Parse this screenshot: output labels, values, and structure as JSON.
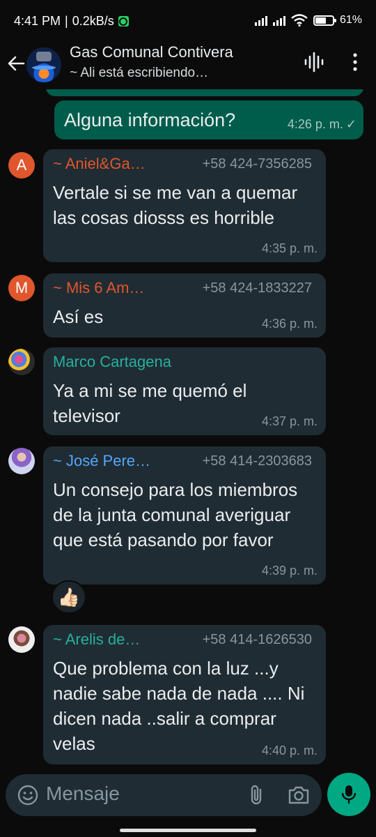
{
  "status": {
    "time": "4:41 PM",
    "speed": "0.2kB/s",
    "battery": "61"
  },
  "header": {
    "title": "Gas Comunal Contivera",
    "subtitle": "~ Ali está escribiendo…"
  },
  "messages": [
    {
      "type": "out",
      "text": "Alguna información?",
      "time": "4:26 p. m."
    },
    {
      "type": "in",
      "avatar_letter": "A",
      "sender": "~ Aniel&Ga…",
      "sender_color": "#e0562d",
      "phone": "+58 424-7356285",
      "text": "Vertale si se me van a quemar las cosas diosss es horrible",
      "time": "4:35 p. m."
    },
    {
      "type": "in",
      "avatar_letter": "M",
      "sender": "~ Mis 6 Am…",
      "sender_color": "#e0562d",
      "phone": "+58 424-1833227",
      "text": "Así es",
      "time": "4:36 p. m."
    },
    {
      "type": "in",
      "sender": "Marco Cartagena",
      "sender_color": "#25b0a0",
      "text": "Ya a mi se me quemó el televisor",
      "time": "4:37 p. m."
    },
    {
      "type": "in",
      "sender": "~ José Pere…",
      "sender_color": "#53a6fc",
      "phone": "+58 414-2303683",
      "text": "Un consejo para los miembros de la junta comunal averiguar que está pasando por favor",
      "time": "4:39 p. m.",
      "reaction": "👍🏻"
    },
    {
      "type": "in",
      "sender": "~ Arelis de…",
      "sender_color": "#25b0a0",
      "phone": "+58 414-1626530",
      "text": "Que problema con la luz ...y nadie sabe nada de nada .... Ni dicen nada ..salir a comprar velas",
      "time": "4:40 p. m."
    }
  ],
  "input": {
    "placeholder": "Mensaje"
  },
  "icons": {
    "back": "arrow-left-icon",
    "voice": "audio-waveform-icon",
    "more": "more-vertical-icon",
    "emoji": "emoji-icon",
    "attach": "paperclip-icon",
    "camera": "camera-icon",
    "mic": "microphone-icon"
  },
  "colors": {
    "outgoing_bubble": "#005c4b",
    "incoming_bubble": "#202c33",
    "accent": "#00a884"
  }
}
